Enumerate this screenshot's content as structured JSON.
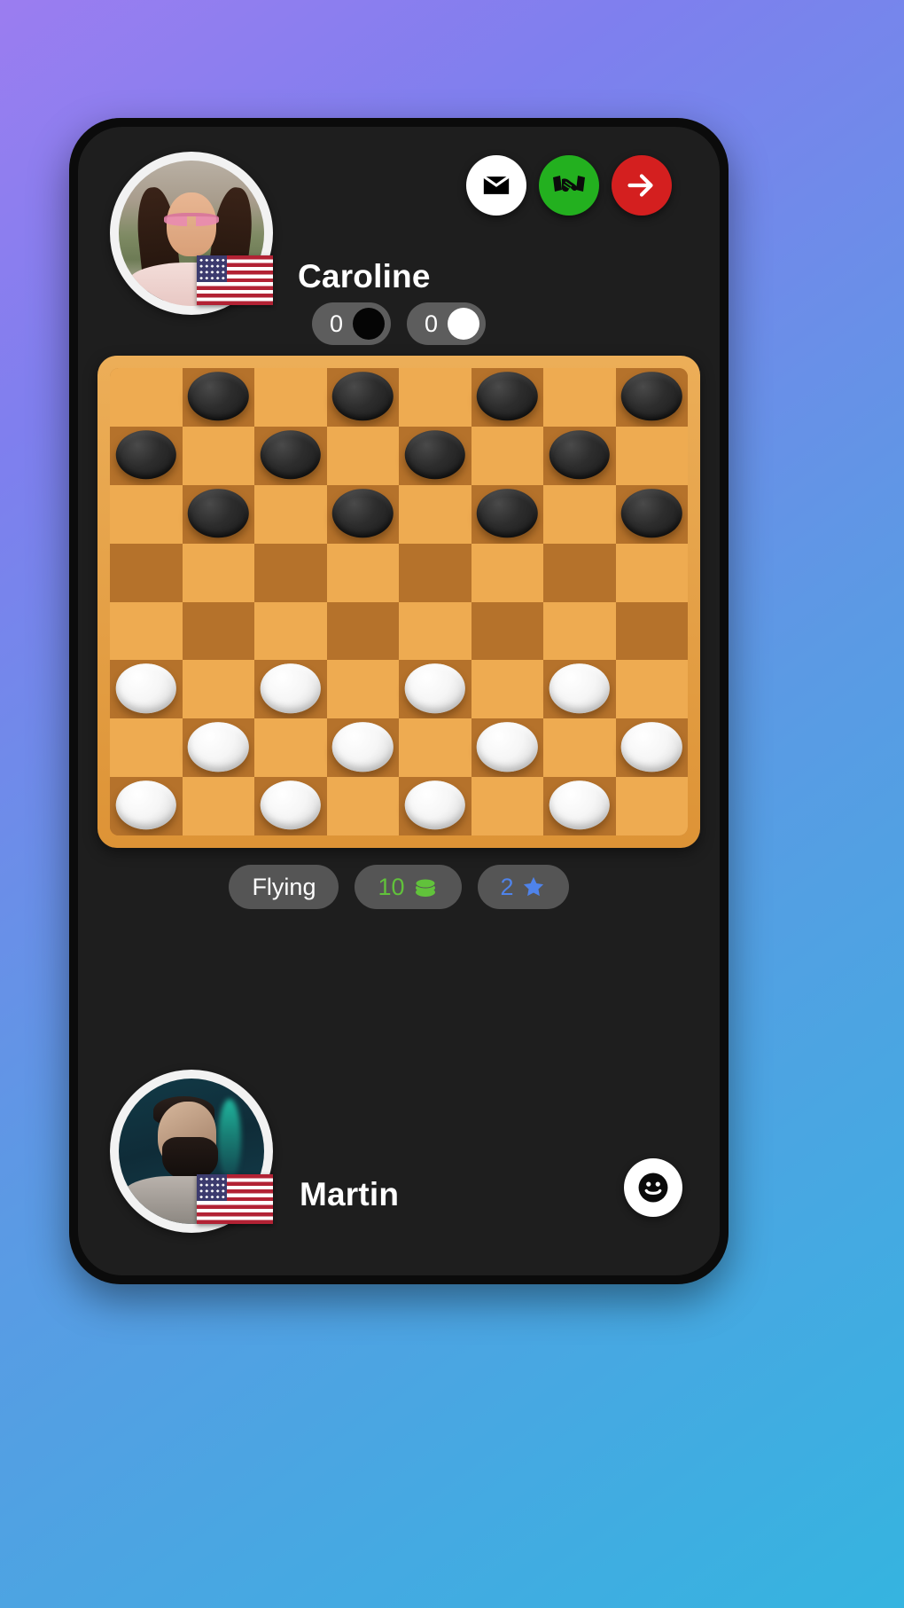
{
  "app": {
    "screen_name": "checkers-game-board",
    "background_gradient": [
      "#9b7df0",
      "#5b9ae4",
      "#35b4e0"
    ],
    "screen_background": "#1e1e1e"
  },
  "header": {
    "actions": [
      {
        "name": "message-button",
        "icon": "mail-icon",
        "label": "Message",
        "bg": "#ffffff",
        "fg": "#000000"
      },
      {
        "name": "draw-button",
        "icon": "handshake-icon",
        "label": "Draw",
        "bg": "#23b01f",
        "fg": "#000000"
      },
      {
        "name": "resign-button",
        "icon": "arrow-right-icon",
        "label": "Resign",
        "bg": "#d41f1f",
        "fg": "#ffffff"
      }
    ]
  },
  "top_player": {
    "name": "Caroline",
    "flag": "us-flag",
    "avatar": "caroline-avatar"
  },
  "bottom_player": {
    "name": "Martin",
    "flag": "us-flag",
    "avatar": "martin-avatar"
  },
  "scores": [
    {
      "name": "black-captures",
      "value": "0",
      "disc": "black",
      "disc_color": "#050505"
    },
    {
      "name": "white-captures",
      "value": "0",
      "disc": "white",
      "disc_color": "#ffffff"
    }
  ],
  "info_pills": [
    {
      "name": "variant-pill",
      "value": "Flying",
      "icon": "",
      "color": "#ffffff"
    },
    {
      "name": "coins-pill",
      "value": "10",
      "icon": "coins-icon",
      "color": "#61c23b"
    },
    {
      "name": "rating-pill",
      "value": "2",
      "icon": "star-icon",
      "color": "#4f83ea"
    }
  ],
  "emoji_button": {
    "name": "emoji-button",
    "icon": "smiley-icon",
    "label": "Emoji"
  },
  "board": {
    "rows": 8,
    "cols": 8,
    "light_square": "#eeab51",
    "dark_square": "#b5722b",
    "frame_color": "#e5a34a",
    "black_piece_color": "#2d2d2d",
    "white_piece_color": "#f6f6f6",
    "layout": [
      [
        "",
        "b",
        "",
        "b",
        "",
        "b",
        "",
        "b"
      ],
      [
        "b",
        "",
        "b",
        "",
        "b",
        "",
        "b",
        ""
      ],
      [
        "",
        "b",
        "",
        "b",
        "",
        "b",
        "",
        "b"
      ],
      [
        "",
        "",
        "",
        "",
        "",
        "",
        "",
        ""
      ],
      [
        "",
        "",
        "",
        "",
        "",
        "",
        "",
        ""
      ],
      [
        "w",
        "",
        "w",
        "",
        "w",
        "",
        "w",
        ""
      ],
      [
        "",
        "w",
        "",
        "w",
        "",
        "w",
        "",
        "w"
      ],
      [
        "w",
        "",
        "w",
        "",
        "w",
        "",
        "w",
        ""
      ]
    ]
  }
}
